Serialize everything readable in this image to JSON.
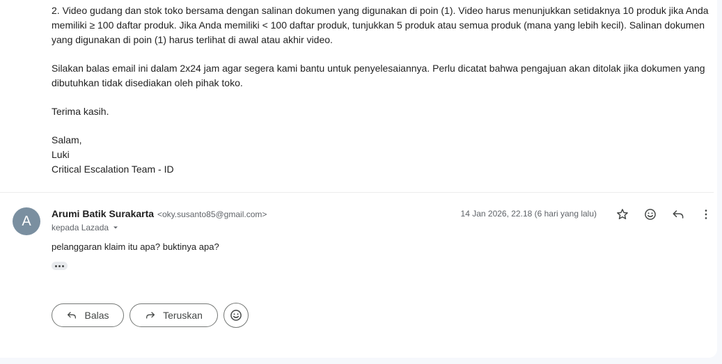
{
  "previous_message": {
    "paragraph_video": "2. Video gudang dan stok toko bersama dengan salinan dokumen yang digunakan di poin (1). Video harus menunjukkan setidaknya 10 produk jika Anda memiliki ≥ 100 daftar produk. Jika Anda memiliki < 100 daftar produk, tunjukkan 5 produk atau semua produk (mana yang lebih kecil). Salinan dokumen yang digunakan di poin (1) harus terlihat di awal atau akhir video.",
    "paragraph_reply": "Silakan balas email ini dalam 2x24 jam agar segera kami bantu untuk penyelesaiannya. Perlu dicatat bahwa pengajuan akan ditolak jika dokumen yang dibutuhkan tidak disediakan oleh pihak toko.",
    "thanks": "Terima kasih.",
    "signature": {
      "greeting": "Salam,",
      "name": "Luki",
      "team": "Critical Escalation Team - ID"
    }
  },
  "message": {
    "avatar_letter": "A",
    "avatar_color": "#7a8fa0",
    "sender_name": "Arumi Batik Surakarta",
    "sender_email": "<oky.susanto85@gmail.com>",
    "recipient": "kepada Lazada",
    "timestamp": "14 Jan 2026, 22.18 (6 hari yang lalu)",
    "body": "pelanggaran klaim itu apa? buktinya apa?",
    "header_icons": [
      "star-icon",
      "emoji-reaction-icon",
      "reply-icon",
      "more-vert-icon"
    ]
  },
  "actions": {
    "reply_label": "Balas",
    "forward_label": "Teruskan"
  }
}
